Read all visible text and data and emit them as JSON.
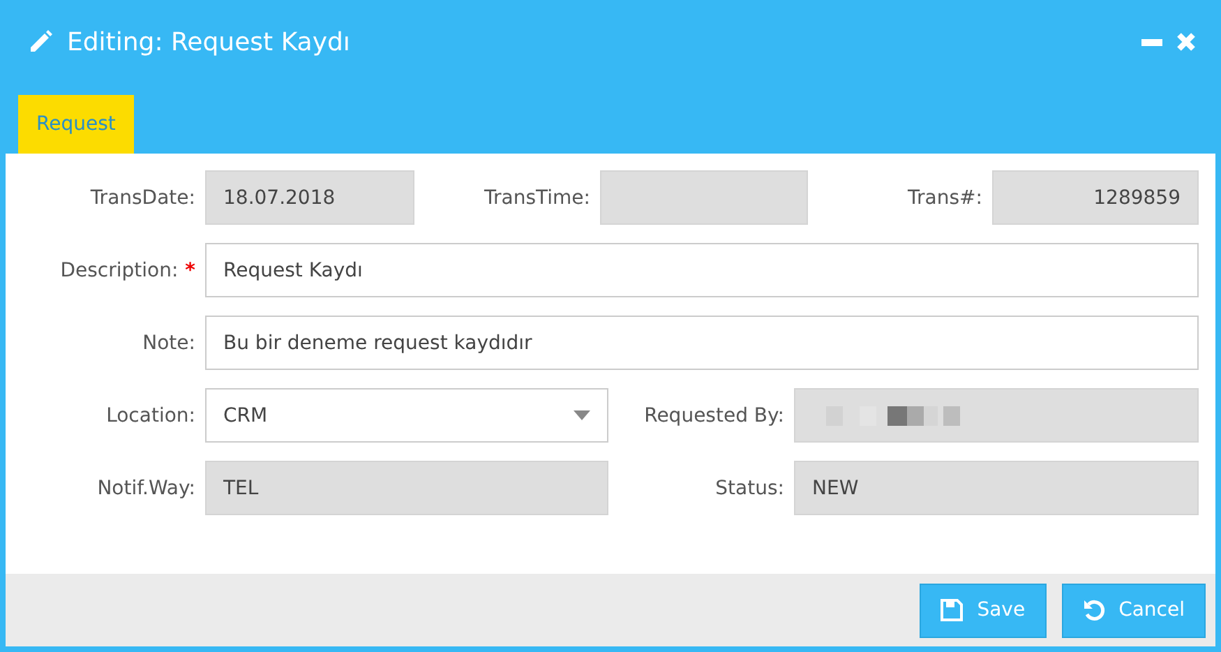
{
  "window": {
    "title": "Editing: Request Kaydı"
  },
  "tabs": [
    {
      "label": "Request",
      "selected": true
    }
  ],
  "rows": [
    {
      "fields": [
        {
          "label": "TransDate:",
          "kind": "readonly",
          "value": "18.07.2018"
        },
        {
          "label": "TransTime:",
          "kind": "readonly"
        },
        {
          "label": "Trans#:",
          "kind": "readonly-number",
          "value": "1289859"
        }
      ]
    },
    {
      "fields": [
        {
          "label": "Description:",
          "required_mark": "*",
          "kind": "text",
          "value": "Request Kaydı"
        }
      ]
    },
    {
      "fields": [
        {
          "label": "Note:",
          "kind": "text",
          "value": "Bu bir deneme request kaydıdır"
        }
      ]
    },
    {
      "fields": [
        {
          "label": "Location:",
          "kind": "select",
          "value": "CRM"
        },
        {
          "label": "Requested By:",
          "kind": "pixelated"
        }
      ]
    },
    {
      "fields": [
        {
          "label": "Notif.Way:",
          "kind": "readonly",
          "value": "TEL"
        },
        {
          "label": "Status:",
          "kind": "readonly",
          "value": "NEW"
        }
      ]
    }
  ],
  "buttons": [
    {
      "label": "Save",
      "kind": "save"
    },
    {
      "label": "Cancel",
      "kind": "cancel"
    }
  ]
}
